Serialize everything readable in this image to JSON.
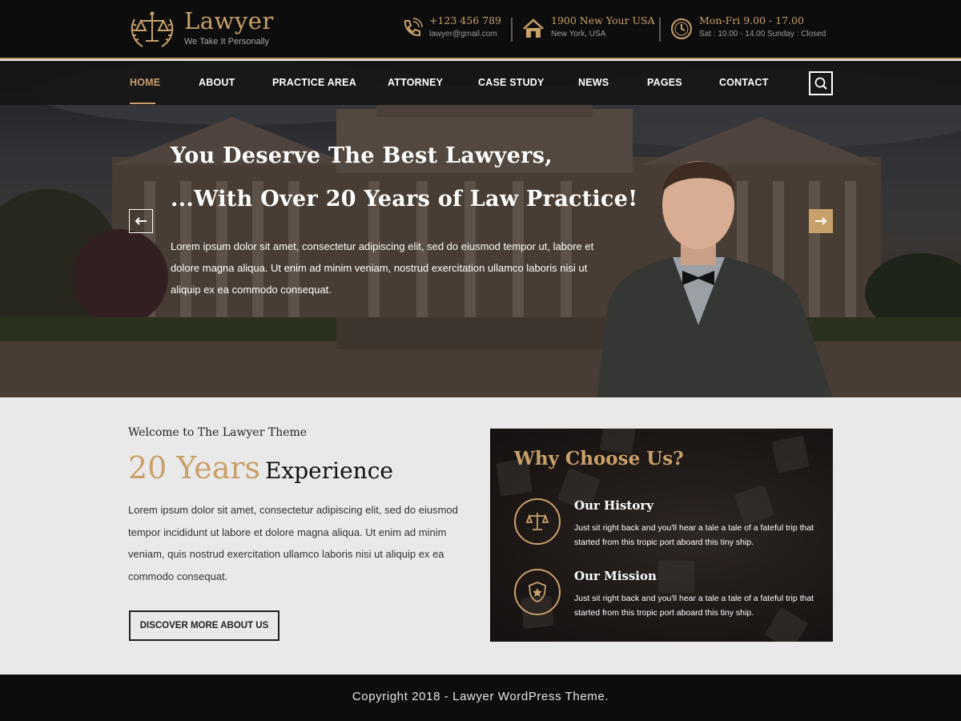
{
  "brand": {
    "name": "Lawyer",
    "tagline": "We Take It Personally"
  },
  "contact": {
    "phone": "+123 456 789",
    "email": "lawyer@gmail.com",
    "address": "1900 New Your USA",
    "city": "New York, USA",
    "hours": "Mon-Fri 9.00 - 17.00",
    "hours_detail": "Sat : 10.00 - 14.00 Sunday : Closed"
  },
  "nav": {
    "items": [
      {
        "label": "HOME",
        "active": true
      },
      {
        "label": "ABOUT"
      },
      {
        "label": "PRACTICE AREA"
      },
      {
        "label": "ATTORNEY"
      },
      {
        "label": "CASE STUDY"
      },
      {
        "label": "NEWS"
      },
      {
        "label": "PAGES"
      },
      {
        "label": "CONTACT"
      }
    ]
  },
  "hero": {
    "title_line1": "You Deserve The Best Lawyers,",
    "title_line2": "...With Over 20 Years of Law Practice!",
    "text": "Lorem ipsum dolor sit amet, consectetur adipiscing elit, sed do eiusmod tempor ut, labore et dolore magna aliqua. Ut enim ad minim veniam, nostrud exercitation ullamco laboris nisi ut aliquip ex ea commodo consequat."
  },
  "welcome": {
    "subtitle": "Welcome to The Lawyer Theme",
    "years": "20 Years",
    "experience": "Experience",
    "text": "Lorem ipsum dolor sit amet, consectetur adipiscing elit, sed do eiusmod tempor incididunt ut labore et dolore magna aliqua. Ut enim ad minim veniam, quis nostrud exercitation ullamco laboris nisi ut aliquip ex ea commodo consequat.",
    "button": "DISCOVER MORE ABOUT US"
  },
  "why": {
    "title": "Why Choose Us?",
    "items": [
      {
        "heading": "Our History",
        "text": "Just sit right back and you'll hear a tale a tale of a fateful trip that started from this tropic port aboard this tiny ship.",
        "icon": "scales-icon"
      },
      {
        "heading": "Our Mission",
        "text": "Just sit right back and you'll hear a tale a tale of a fateful trip that started from this tropic port aboard this tiny ship.",
        "icon": "shield-star-icon"
      }
    ]
  },
  "footer": {
    "copyright": "Copyright 2018 - Lawyer WordPress Theme."
  },
  "colors": {
    "accent": "#c8a06a",
    "dark": "#0d0d0d",
    "light_bg": "#e9e9e9"
  }
}
